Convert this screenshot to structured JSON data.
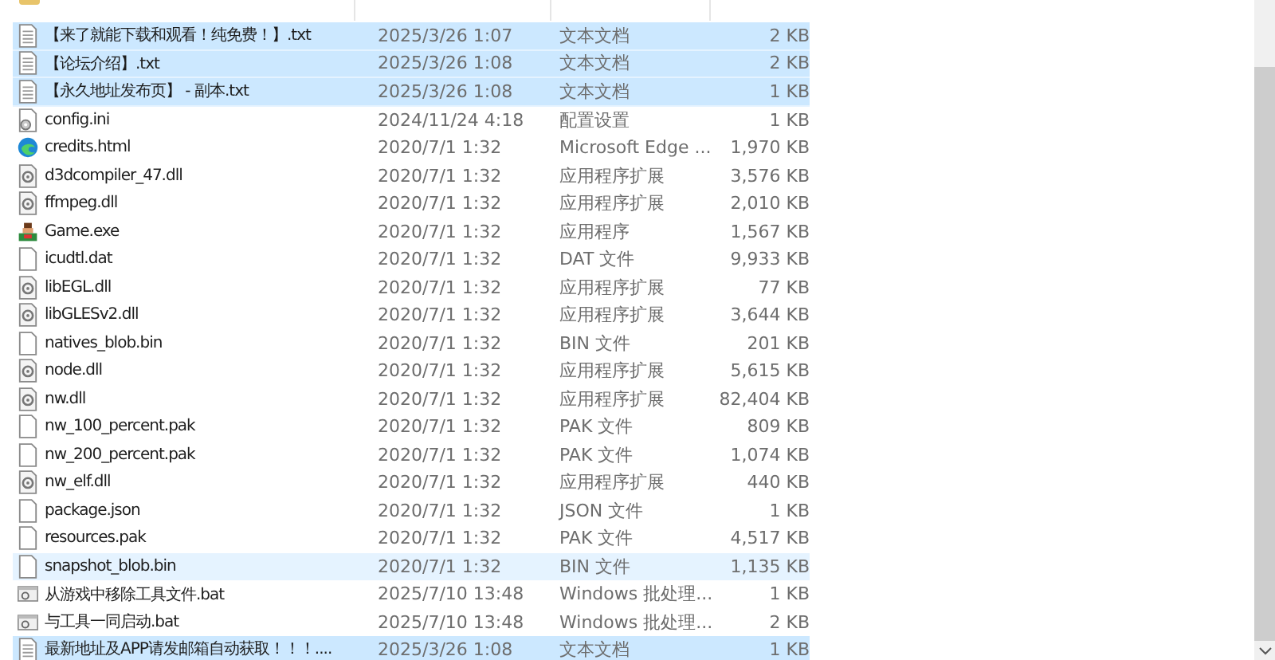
{
  "files": [
    {
      "name": "【来了就能下载和观看！纯免费！】.txt",
      "modified": "2025/3/26 1:07",
      "type": "文本文档",
      "size": "2 KB",
      "kind": "txt",
      "selected": true,
      "hovered": false
    },
    {
      "name": "【论坛介绍】.txt",
      "modified": "2025/3/26 1:08",
      "type": "文本文档",
      "size": "2 KB",
      "kind": "txt",
      "selected": true,
      "hovered": false
    },
    {
      "name": "【永久地址发布页】 - 副本.txt",
      "modified": "2025/3/26 1:08",
      "type": "文本文档",
      "size": "1 KB",
      "kind": "txt",
      "selected": true,
      "hovered": false
    },
    {
      "name": "config.ini",
      "modified": "2024/11/24 4:18",
      "type": "配置设置",
      "size": "1 KB",
      "kind": "ini",
      "selected": false,
      "hovered": false
    },
    {
      "name": "credits.html",
      "modified": "2020/7/1 1:32",
      "type": "Microsoft Edge ...",
      "size": "1,970 KB",
      "kind": "html",
      "selected": false,
      "hovered": false
    },
    {
      "name": "d3dcompiler_47.dll",
      "modified": "2020/7/1 1:32",
      "type": "应用程序扩展",
      "size": "3,576 KB",
      "kind": "dll",
      "selected": false,
      "hovered": false
    },
    {
      "name": "ffmpeg.dll",
      "modified": "2020/7/1 1:32",
      "type": "应用程序扩展",
      "size": "2,010 KB",
      "kind": "dll",
      "selected": false,
      "hovered": false
    },
    {
      "name": "Game.exe",
      "modified": "2020/7/1 1:32",
      "type": "应用程序",
      "size": "1,567 KB",
      "kind": "exe",
      "selected": false,
      "hovered": false
    },
    {
      "name": "icudtl.dat",
      "modified": "2020/7/1 1:32",
      "type": "DAT 文件",
      "size": "9,933 KB",
      "kind": "blank",
      "selected": false,
      "hovered": false
    },
    {
      "name": "libEGL.dll",
      "modified": "2020/7/1 1:32",
      "type": "应用程序扩展",
      "size": "77 KB",
      "kind": "dll",
      "selected": false,
      "hovered": false
    },
    {
      "name": "libGLESv2.dll",
      "modified": "2020/7/1 1:32",
      "type": "应用程序扩展",
      "size": "3,644 KB",
      "kind": "dll",
      "selected": false,
      "hovered": false
    },
    {
      "name": "natives_blob.bin",
      "modified": "2020/7/1 1:32",
      "type": "BIN 文件",
      "size": "201 KB",
      "kind": "blank",
      "selected": false,
      "hovered": false
    },
    {
      "name": "node.dll",
      "modified": "2020/7/1 1:32",
      "type": "应用程序扩展",
      "size": "5,615 KB",
      "kind": "dll",
      "selected": false,
      "hovered": false
    },
    {
      "name": "nw.dll",
      "modified": "2020/7/1 1:32",
      "type": "应用程序扩展",
      "size": "82,404 KB",
      "kind": "dll",
      "selected": false,
      "hovered": false
    },
    {
      "name": "nw_100_percent.pak",
      "modified": "2020/7/1 1:32",
      "type": "PAK 文件",
      "size": "809 KB",
      "kind": "blank",
      "selected": false,
      "hovered": false
    },
    {
      "name": "nw_200_percent.pak",
      "modified": "2020/7/1 1:32",
      "type": "PAK 文件",
      "size": "1,074 KB",
      "kind": "blank",
      "selected": false,
      "hovered": false
    },
    {
      "name": "nw_elf.dll",
      "modified": "2020/7/1 1:32",
      "type": "应用程序扩展",
      "size": "440 KB",
      "kind": "dll",
      "selected": false,
      "hovered": false
    },
    {
      "name": "package.json",
      "modified": "2020/7/1 1:32",
      "type": "JSON 文件",
      "size": "1 KB",
      "kind": "blank",
      "selected": false,
      "hovered": false
    },
    {
      "name": "resources.pak",
      "modified": "2020/7/1 1:32",
      "type": "PAK 文件",
      "size": "4,517 KB",
      "kind": "blank",
      "selected": false,
      "hovered": false
    },
    {
      "name": "snapshot_blob.bin",
      "modified": "2020/7/1 1:32",
      "type": "BIN 文件",
      "size": "1,135 KB",
      "kind": "blank",
      "selected": false,
      "hovered": true
    },
    {
      "name": "从游戏中移除工具文件.bat",
      "modified": "2025/7/10 13:48",
      "type": "Windows 批处理...",
      "size": "1 KB",
      "kind": "bat",
      "selected": false,
      "hovered": false
    },
    {
      "name": "与工具一同启动.bat",
      "modified": "2025/7/10 13:48",
      "type": "Windows 批处理...",
      "size": "2 KB",
      "kind": "bat",
      "selected": false,
      "hovered": false
    },
    {
      "name": "最新地址及APP请发邮箱自动获取！！！....",
      "modified": "2025/3/26 1:08",
      "type": "文本文档",
      "size": "1 KB",
      "kind": "txt",
      "selected": true,
      "hovered": false
    }
  ]
}
